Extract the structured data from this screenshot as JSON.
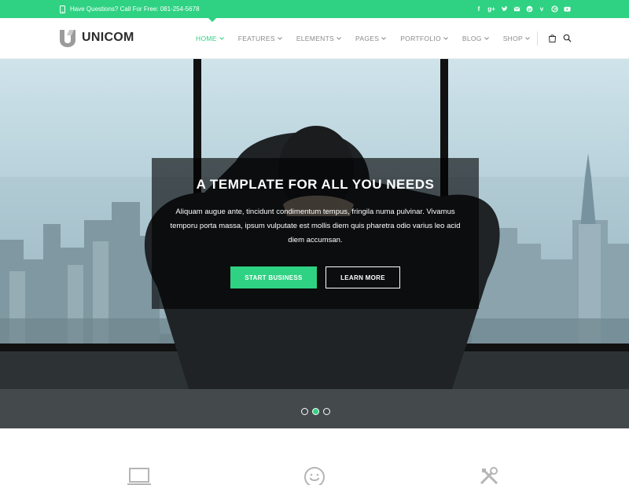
{
  "topbar": {
    "contact_text": "Have Questions? Call For Free: 081-254-5678",
    "social_icons": [
      "facebook-icon",
      "google-plus-icon",
      "twitter-icon",
      "email-icon",
      "pinterest-icon",
      "vimeo-icon",
      "dribbble-icon",
      "youtube-icon"
    ]
  },
  "brand": {
    "name": "UNICOM"
  },
  "nav": {
    "items": [
      {
        "label": "HOME"
      },
      {
        "label": "FEATURES"
      },
      {
        "label": "ELEMENTS"
      },
      {
        "label": "PAGES"
      },
      {
        "label": "PORTFOLIO"
      },
      {
        "label": "BLOG"
      },
      {
        "label": "SHOP"
      }
    ],
    "active": "HOME"
  },
  "hero": {
    "title": "A TEMPLATE FOR ALL YOU NEEDS",
    "text": "Aliquam augue ante, tincidunt condimentum tempus, fringila numa pulvinar. Vivamus temporu porta massa, ipsum vulputate est mollis diem quis pharetra odio varius leo acid diem accumsan.",
    "primary_button": "START BUSINESS",
    "secondary_button": "LEARN MORE",
    "slides": 3,
    "active_slide": 2
  },
  "features": {
    "icons": [
      "laptop-icon",
      "smiley-icon",
      "tools-icon"
    ]
  },
  "colors": {
    "accent": "#2fd282",
    "dark": "#2b2b2b",
    "nav_text": "#8a8a8a"
  }
}
